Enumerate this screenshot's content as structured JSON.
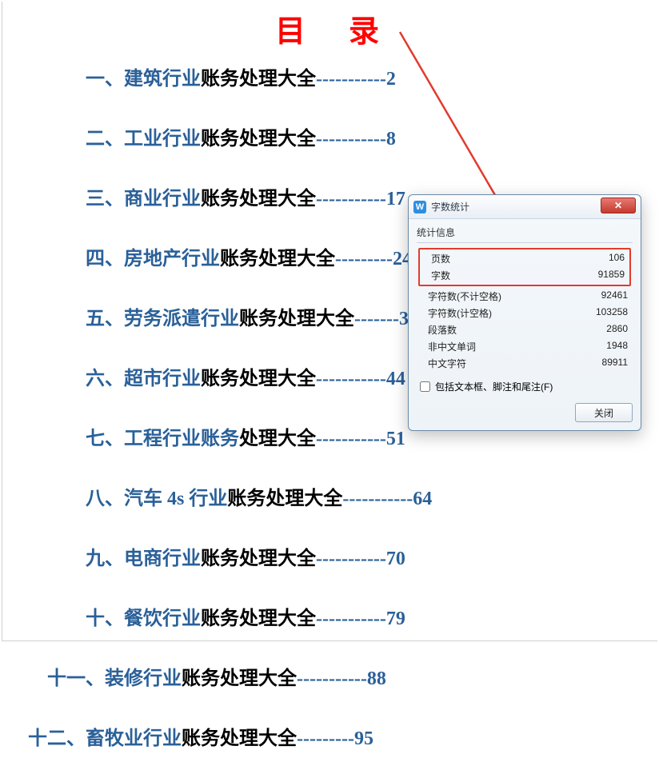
{
  "title_parts": {
    "a": "目",
    "b": "录"
  },
  "toc": [
    {
      "num": "一、",
      "hl": "建筑行业",
      "rest": "账务处理大全",
      "page": "2",
      "num_w": 155,
      "leader": "-----------"
    },
    {
      "num": "二、",
      "hl": "工业行业",
      "rest": "账务处理大全",
      "page": "8",
      "num_w": 155,
      "leader": "-----------"
    },
    {
      "num": "三、",
      "hl": "商业行业",
      "rest": "账务处理大全",
      "page": "17",
      "num_w": 155,
      "leader": "-----------"
    },
    {
      "num": "四、",
      "hl": "房地产行业",
      "rest": "账务处理大全",
      "page": "24",
      "num_w": 155,
      "leader": "---------"
    },
    {
      "num": "五、",
      "hl": "劳务派遣行业",
      "rest": "账务处理大全",
      "page": "32",
      "num_w": 155,
      "leader": "-------"
    },
    {
      "num": "六、",
      "hl": "超市行业",
      "rest": "账务处理大全",
      "page": "44",
      "num_w": 155,
      "leader": "-----------"
    },
    {
      "num": "七、",
      "hl": "工程行业账务",
      "rest": "处理大全",
      "page": "51",
      "num_w": 155,
      "leader": "-----------"
    },
    {
      "num": "八、",
      "hl": "汽车 4s 行业",
      "rest": "账务处理大全",
      "page": "64",
      "num_w": 155,
      "leader": "-----------"
    },
    {
      "num": "九、",
      "hl": "电商行业",
      "rest": "账务处理大全",
      "page": "70",
      "num_w": 155,
      "leader": "-----------"
    },
    {
      "num": "十、",
      "hl": "餐饮行业",
      "rest": "账务处理大全",
      "page": "79",
      "num_w": 155,
      "leader": "-----------"
    },
    {
      "num": "十一、",
      "hl": "装修行业",
      "rest": "账务处理大全",
      "page": "88",
      "num_w": 131,
      "leader": "-----------"
    },
    {
      "num": "十二、",
      "hl": "畜牧业行业",
      "rest": "账务处理大全",
      "page": "95",
      "num_w": 107,
      "leader": "---------"
    }
  ],
  "dialog": {
    "title": "字数统计",
    "group_label": "统计信息",
    "stats_highlighted": [
      {
        "label": "页数",
        "value": "106"
      },
      {
        "label": "字数",
        "value": "91859"
      }
    ],
    "stats_rest": [
      {
        "label": "字符数(不计空格)",
        "value": "92461"
      },
      {
        "label": "字符数(计空格)",
        "value": "103258"
      },
      {
        "label": "段落数",
        "value": "2860"
      },
      {
        "label": "非中文单词",
        "value": "1948"
      },
      {
        "label": "中文字符",
        "value": "89911"
      }
    ],
    "checkbox_label": "包括文本框、脚注和尾注(F)",
    "close_button": "关闭"
  }
}
